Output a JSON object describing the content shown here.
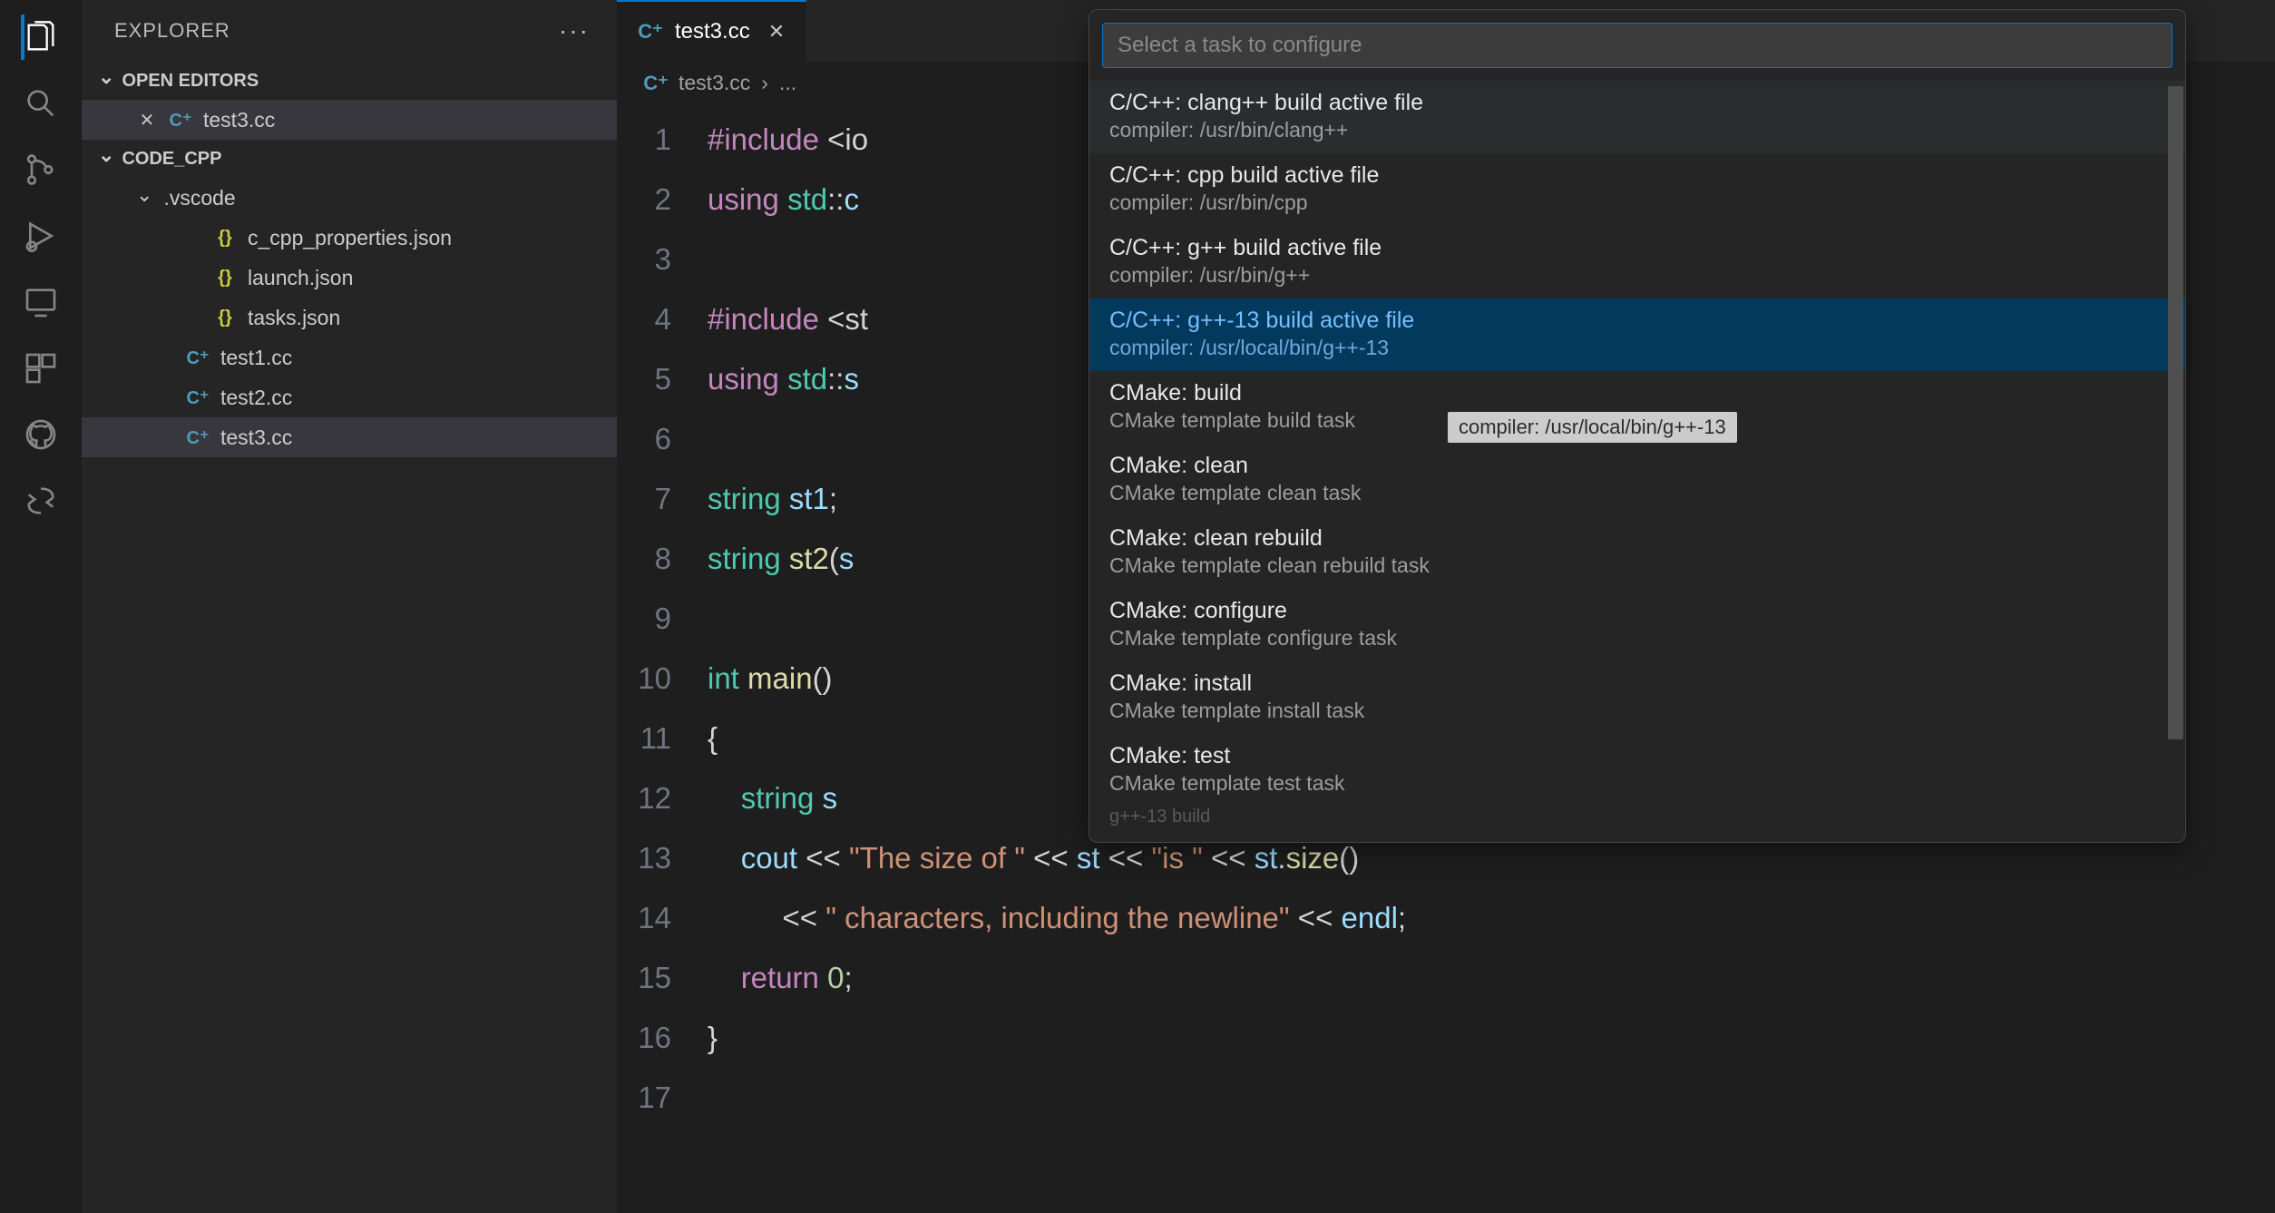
{
  "sidebar": {
    "title": "EXPLORER",
    "sections": {
      "open_editors": {
        "label": "OPEN EDITORS",
        "items": [
          {
            "name": "test3.cc",
            "icon": "cpp"
          }
        ]
      },
      "folder": {
        "label": "CODE_CPP",
        "items": [
          {
            "name": ".vscode",
            "kind": "folder",
            "open": true
          },
          {
            "name": "c_cpp_properties.json",
            "kind": "json",
            "indent": 2
          },
          {
            "name": "launch.json",
            "kind": "json",
            "indent": 2
          },
          {
            "name": "tasks.json",
            "kind": "json",
            "indent": 2
          },
          {
            "name": "test1.cc",
            "kind": "cpp",
            "indent": 1
          },
          {
            "name": "test2.cc",
            "kind": "cpp",
            "indent": 1
          },
          {
            "name": "test3.cc",
            "kind": "cpp",
            "indent": 1,
            "selected": true
          }
        ]
      }
    }
  },
  "tab": {
    "filename": "test3.cc"
  },
  "breadcrumb": {
    "file": "test3.cc",
    "rest": "..."
  },
  "code_lines": [
    {
      "n": "1",
      "tokens": [
        [
          "kw",
          "#include"
        ],
        [
          "pn",
          " <io"
        ]
      ]
    },
    {
      "n": "2",
      "tokens": [
        [
          "kw",
          "using"
        ],
        [
          "pn",
          " "
        ],
        [
          "ty",
          "std"
        ],
        [
          "op",
          "::"
        ],
        [
          "id",
          "c"
        ]
      ]
    },
    {
      "n": "3",
      "tokens": []
    },
    {
      "n": "4",
      "tokens": [
        [
          "kw",
          "#include"
        ],
        [
          "pn",
          " <st"
        ]
      ]
    },
    {
      "n": "5",
      "tokens": [
        [
          "kw",
          "using"
        ],
        [
          "pn",
          " "
        ],
        [
          "ty",
          "std"
        ],
        [
          "op",
          "::"
        ],
        [
          "id",
          "s"
        ]
      ]
    },
    {
      "n": "6",
      "tokens": []
    },
    {
      "n": "7",
      "tokens": [
        [
          "ty",
          "string"
        ],
        [
          "pn",
          " "
        ],
        [
          "id",
          "st1"
        ],
        [
          "pn",
          ";"
        ]
      ]
    },
    {
      "n": "8",
      "tokens": [
        [
          "ty",
          "string"
        ],
        [
          "pn",
          " "
        ],
        [
          "fn",
          "st2"
        ],
        [
          "pn",
          "("
        ],
        [
          "id",
          "s"
        ]
      ]
    },
    {
      "n": "9",
      "tokens": []
    },
    {
      "n": "10",
      "tokens": [
        [
          "ty",
          "int"
        ],
        [
          "pn",
          " "
        ],
        [
          "fn",
          "main"
        ],
        [
          "pn",
          "()"
        ]
      ]
    },
    {
      "n": "11",
      "tokens": [
        [
          "pn",
          "{"
        ]
      ]
    },
    {
      "n": "12",
      "tokens": [
        [
          "pn",
          "    "
        ],
        [
          "ty",
          "string"
        ],
        [
          "pn",
          " "
        ],
        [
          "id",
          "s"
        ]
      ]
    },
    {
      "n": "13",
      "tokens": [
        [
          "pn",
          "    "
        ],
        [
          "id",
          "cout"
        ],
        [
          "pn",
          " "
        ],
        [
          "op",
          "<<"
        ],
        [
          "pn",
          " "
        ],
        [
          "str",
          "\"The size of \""
        ],
        [
          "pn",
          " "
        ],
        [
          "op",
          "<<"
        ],
        [
          "pn",
          " "
        ],
        [
          "id",
          "st"
        ],
        [
          "pn",
          " "
        ],
        [
          "op",
          "<<"
        ],
        [
          "pn",
          " "
        ],
        [
          "str",
          "\"is \""
        ],
        [
          "pn",
          " "
        ],
        [
          "op",
          "<<"
        ],
        [
          "pn",
          " "
        ],
        [
          "id",
          "st"
        ],
        [
          "pn",
          "."
        ],
        [
          "fn",
          "size"
        ],
        [
          "pn",
          "()"
        ]
      ]
    },
    {
      "n": "14",
      "tokens": [
        [
          "pn",
          "         "
        ],
        [
          "op",
          "<<"
        ],
        [
          "pn",
          " "
        ],
        [
          "str",
          "\" characters, including the newline\""
        ],
        [
          "pn",
          " "
        ],
        [
          "op",
          "<<"
        ],
        [
          "pn",
          " "
        ],
        [
          "id",
          "endl"
        ],
        [
          "pn",
          ";"
        ]
      ]
    },
    {
      "n": "15",
      "tokens": [
        [
          "pn",
          "    "
        ],
        [
          "kw",
          "return"
        ],
        [
          "pn",
          " "
        ],
        [
          "num",
          "0"
        ],
        [
          "pn",
          ";"
        ]
      ]
    },
    {
      "n": "16",
      "tokens": [
        [
          "pn",
          "}"
        ]
      ]
    },
    {
      "n": "17",
      "tokens": []
    }
  ],
  "quickpick": {
    "placeholder": "Select a task to configure",
    "items": [
      {
        "title": "C/C++: clang++ build active file",
        "desc": "compiler: /usr/bin/clang++",
        "state": "hovered"
      },
      {
        "title": "C/C++: cpp build active file",
        "desc": "compiler: /usr/bin/cpp"
      },
      {
        "title": "C/C++: g++ build active file",
        "desc": "compiler: /usr/bin/g++"
      },
      {
        "title": "C/C++: g++-13 build active file",
        "desc": "compiler: /usr/local/bin/g++-13",
        "state": "selected",
        "circled": true
      },
      {
        "title": "CMake: build",
        "desc": "CMake template build task"
      },
      {
        "title": "CMake: clean",
        "desc": "CMake template clean task"
      },
      {
        "title": "CMake: clean rebuild",
        "desc": "CMake template clean rebuild task"
      },
      {
        "title": "CMake: configure",
        "desc": "CMake template configure task"
      },
      {
        "title": "CMake: install",
        "desc": "CMake template install task"
      },
      {
        "title": "CMake: test",
        "desc": "CMake template test task"
      }
    ],
    "truncated_label": "g++-13 build"
  },
  "tooltip": {
    "text": "compiler: /usr/local/bin/g++-13"
  }
}
